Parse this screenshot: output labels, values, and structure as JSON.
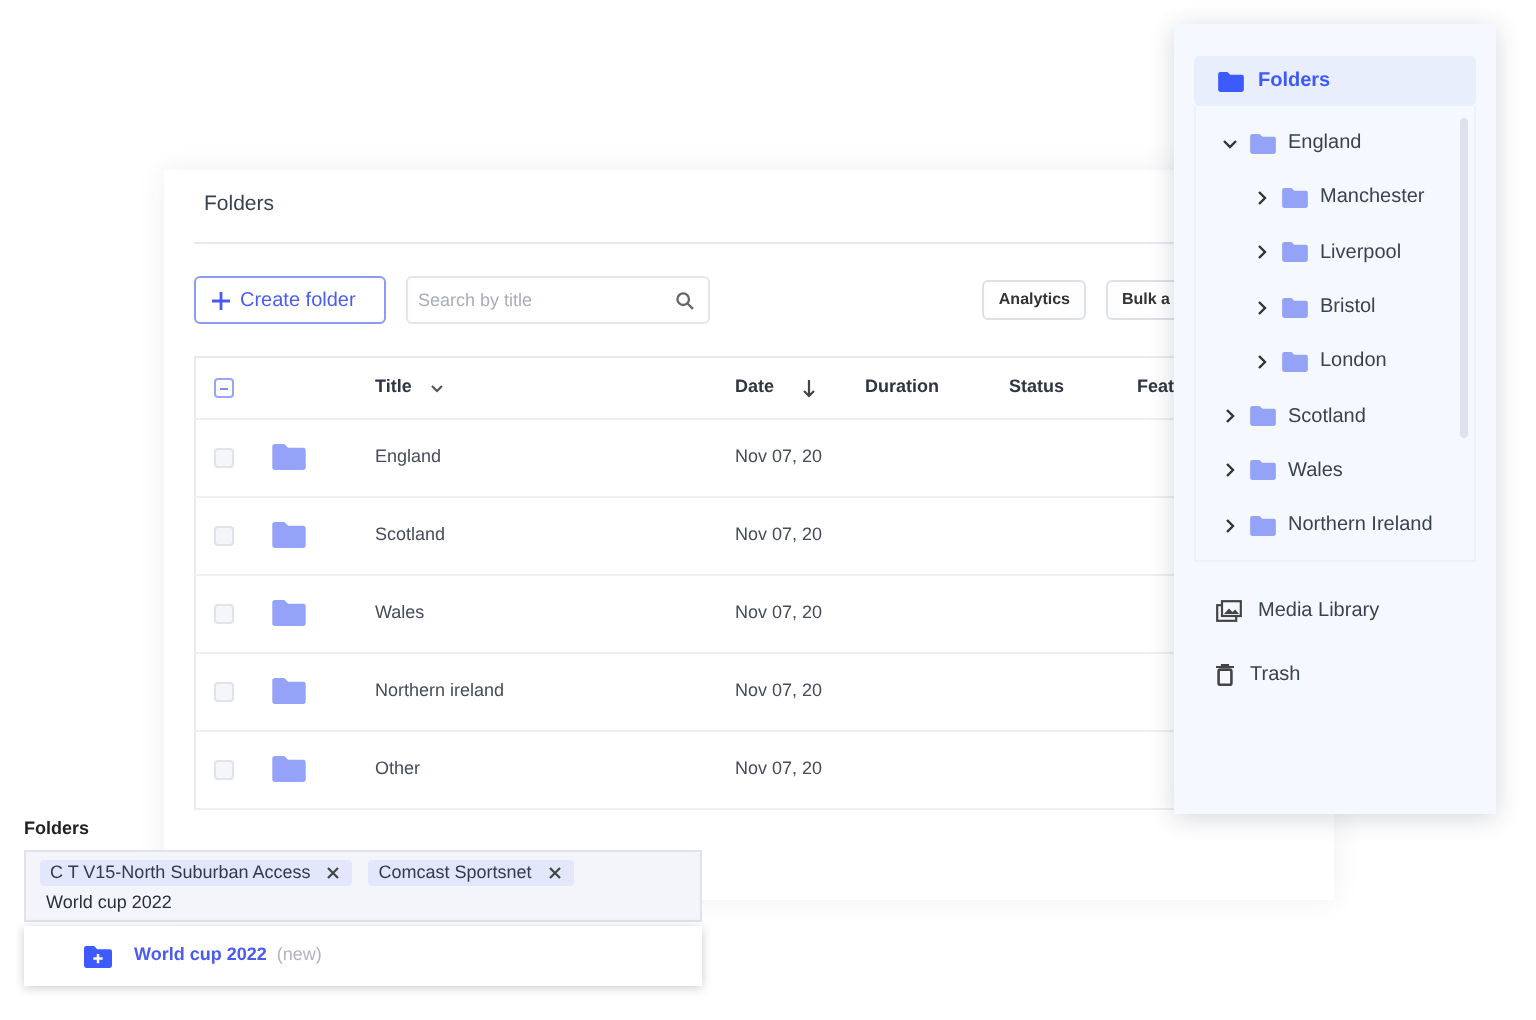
{
  "main_panel": {
    "title": "Folders",
    "create_button": {
      "label": "Create folder"
    },
    "search": {
      "placeholder": "Search by title"
    },
    "buttons": [
      "Analytics",
      "Bulk a"
    ],
    "table": {
      "header_checkbox": {
        "indeterminate": true
      },
      "columns": [
        {
          "label": "Title",
          "has_menu": true,
          "sorted_descending": false
        },
        {
          "label": "Date",
          "has_menu": false,
          "sorted_descending": true
        },
        {
          "label": "Duration",
          "has_menu": false,
          "sorted_descending": false
        },
        {
          "label": "Status",
          "has_menu": false,
          "sorted_descending": false
        },
        {
          "label": "Feat",
          "has_menu": false,
          "sorted_descending": false
        }
      ],
      "rows": [
        {
          "title": "England",
          "date": "Nov 07, 20",
          "checked": false
        },
        {
          "title": "Scotland",
          "date": "Nov 07, 20",
          "checked": false
        },
        {
          "title": "Wales",
          "date": "Nov 07, 20",
          "checked": false
        },
        {
          "title": "Northern ireland",
          "date": "Nov 07, 20",
          "checked": false
        },
        {
          "title": "Other",
          "date": "Nov 07, 20",
          "checked": false
        }
      ]
    }
  },
  "sidebar": {
    "header": {
      "label": "Folders",
      "selected": true
    },
    "tree": [
      {
        "label": "England",
        "expanded": true,
        "children": [
          {
            "label": "Manchester",
            "expanded": false
          },
          {
            "label": "Liverpool",
            "expanded": false
          },
          {
            "label": "Bristol",
            "expanded": false
          },
          {
            "label": "London",
            "expanded": false
          }
        ]
      },
      {
        "label": "Scotland",
        "expanded": false
      },
      {
        "label": "Wales",
        "expanded": false
      },
      {
        "label": "Northern Ireland",
        "expanded": false
      }
    ],
    "links": [
      {
        "kind": "media",
        "label": "Media Library",
        "selected": false
      },
      {
        "kind": "trash",
        "label": "Trash",
        "selected": false
      }
    ]
  },
  "tag_field": {
    "label": "Folders",
    "tags": [
      "C T V15-North Suburban Access",
      "Comcast Sportsnet"
    ],
    "value": "World cup 2022",
    "suggestions": [
      {
        "label": "World cup 2022",
        "note": "(new)"
      }
    ]
  }
}
